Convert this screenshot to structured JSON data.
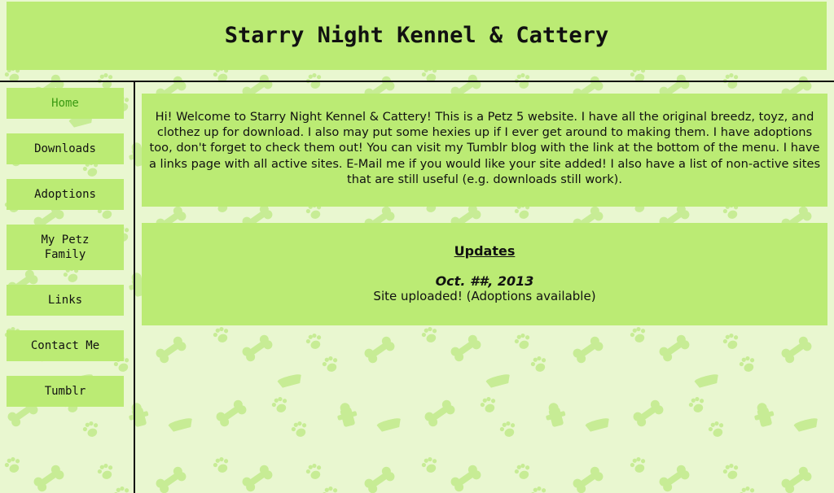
{
  "header": {
    "title": "Starry Night Kennel & Cattery"
  },
  "nav": {
    "items": [
      {
        "label": "Home",
        "active": true
      },
      {
        "label": "Downloads"
      },
      {
        "label": "Adoptions"
      },
      {
        "label": "My Petz Family"
      },
      {
        "label": "Links"
      },
      {
        "label": "Contact Me"
      },
      {
        "label": "Tumblr"
      }
    ]
  },
  "welcome": {
    "text": "Hi! Welcome to Starry Night Kennel & Cattery! This is a Petz 5 website. I have all the original breedz, toyz, and clothez up for download. I also may put some hexies up if I ever get around to making them. I have adoptions too, don't forget to check them out! You can visit my Tumblr blog with the link at the bottom of the menu. I have a links page with all active sites. E-Mail me if you would like your site added! I also have a list of non-active sites that are still useful (e.g. downloads still work)."
  },
  "updates": {
    "heading": "Updates",
    "entries": [
      {
        "date": "Oct. ##, 2013",
        "text": "Site uploaded! (Adoptions available)"
      }
    ]
  },
  "colors": {
    "background": "#e9f7d0",
    "panel": "#bbeb74",
    "pattern": "#c7ec95",
    "active_nav_text": "#3a9a12",
    "divider": "#111111"
  }
}
